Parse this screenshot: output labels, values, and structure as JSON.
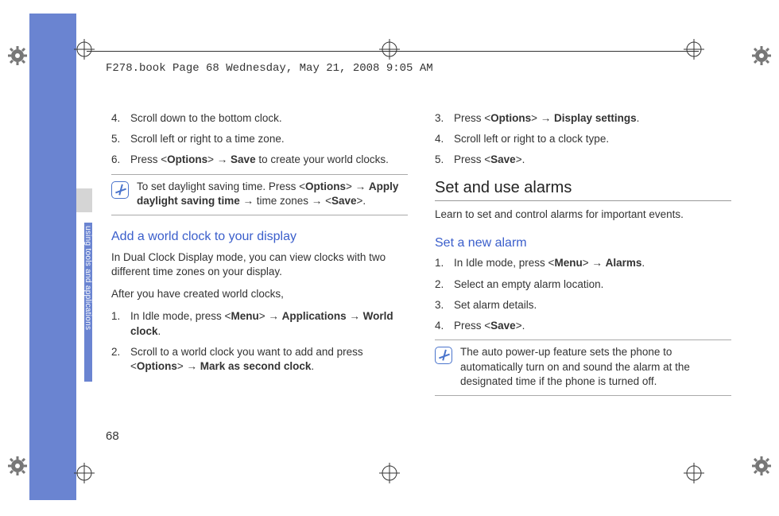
{
  "doc_header": "F278.book  Page 68  Wednesday, May 21, 2008  9:05 AM",
  "sidebar_label": "using tools and applications",
  "page_number": "68",
  "left": {
    "steps_a": [
      {
        "n": "4.",
        "text_pre": "Scroll down to the bottom clock."
      },
      {
        "n": "5.",
        "text_pre": "Scroll left or right to a time zone."
      },
      {
        "n": "6.",
        "text_pre": "Press <",
        "b1": "Options",
        "mid1": "> → ",
        "b2": "Save",
        "after": " to create your world clocks."
      }
    ],
    "note1": {
      "pre": "To set daylight saving time. Press <",
      "b1": "Options",
      "mid1": "> → ",
      "b2": "Apply daylight saving time",
      "mid2": " → time zones → <",
      "b3": "Save",
      "after": ">."
    },
    "h3_add": "Add a world clock to your display",
    "para1": "In Dual Clock Display mode, you can view clocks with two different time zones on your display.",
    "para2": "After you have created world clocks,",
    "steps_b": [
      {
        "n": "1.",
        "pre": "In Idle mode, press <",
        "b1": "Menu",
        "mid1": "> → ",
        "b2": "Applications",
        "mid2": " → ",
        "b3": "World clock",
        "after": "."
      },
      {
        "n": "2.",
        "pre": "Scroll to a world clock you want to add and press <",
        "b1": "Options",
        "mid1": "> → ",
        "b2": "Mark as second clock",
        "after": "."
      }
    ]
  },
  "right": {
    "steps_c": [
      {
        "n": "3.",
        "pre": "Press <",
        "b1": "Options",
        "mid1": "> → ",
        "b2": "Display settings",
        "after": "."
      },
      {
        "n": "4.",
        "pre": "Scroll left or right to a clock type."
      },
      {
        "n": "5.",
        "pre": "Press <",
        "b1": "Save",
        "after": ">."
      }
    ],
    "h2_alarms": "Set and use alarms",
    "para3": "Learn to set and control alarms for important events.",
    "h3_newalarm": "Set a new alarm",
    "steps_d": [
      {
        "n": "1.",
        "pre": "In Idle mode, press <",
        "b1": "Menu",
        "mid1": "> → ",
        "b2": "Alarms",
        "after": "."
      },
      {
        "n": "2.",
        "pre": "Select an empty alarm location."
      },
      {
        "n": "3.",
        "pre": "Set alarm details."
      },
      {
        "n": "4.",
        "pre": "Press <",
        "b1": "Save",
        "after": ">."
      }
    ],
    "note2": "The auto power-up feature sets the phone to automatically turn on and sound the alarm at the designated time if the phone is turned off."
  }
}
